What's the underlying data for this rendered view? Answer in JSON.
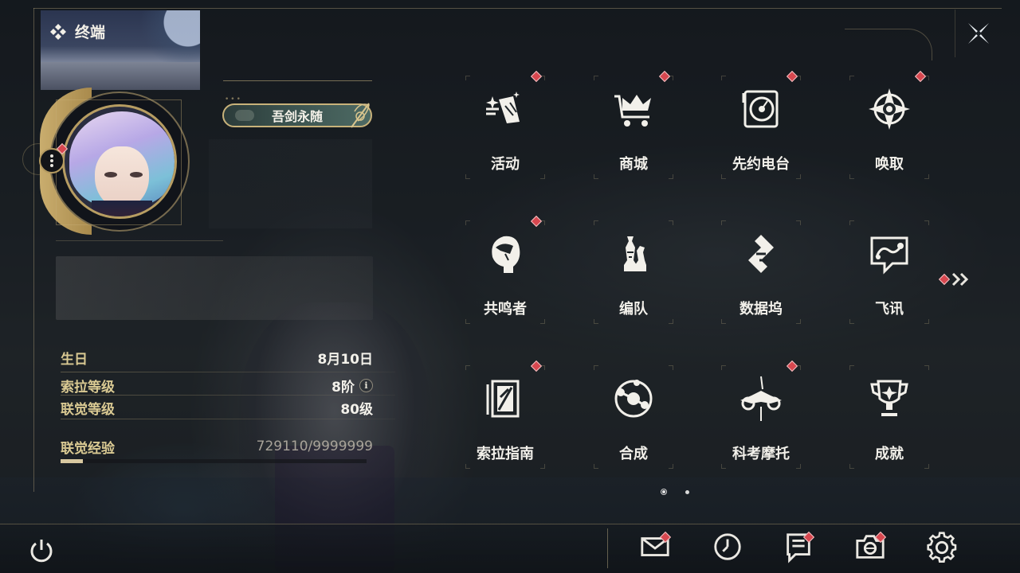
{
  "header": {
    "title": "终端",
    "title_icon": "diamond-cluster-icon",
    "close_icon": "close-x-icon"
  },
  "profile": {
    "avatar_icon": "character-avatar",
    "options_icon": "more-vertical-icon",
    "title_badge": "吾剑永随",
    "stats": {
      "birthday_label": "生日",
      "birthday_value": "8月10日",
      "sola_level_label": "索拉等级",
      "sola_level_value": "8阶",
      "union_level_label": "联觉等级",
      "union_level_value": "80级",
      "union_exp_label": "联觉经验",
      "union_exp_value": "729110/9999999",
      "union_exp_progress": 0.0729,
      "info_icon_text": "i"
    }
  },
  "grid": {
    "tiles": [
      {
        "label": "活动",
        "icon": "sparkle-activity-icon",
        "notify": true
      },
      {
        "label": "商城",
        "icon": "crown-cart-icon",
        "notify": true
      },
      {
        "label": "先约电台",
        "icon": "radio-disc-icon",
        "notify": true
      },
      {
        "label": "唤取",
        "icon": "compass-star-icon",
        "notify": true
      },
      {
        "label": "共鸣者",
        "icon": "character-head-icon",
        "notify": true
      },
      {
        "label": "编队",
        "icon": "chess-pieces-icon",
        "notify": false
      },
      {
        "label": "数据坞",
        "icon": "data-dock-icon",
        "notify": false
      },
      {
        "label": "飞讯",
        "icon": "chat-bubble-icon",
        "notify": false
      },
      {
        "label": "索拉指南",
        "icon": "guide-book-icon",
        "notify": true
      },
      {
        "label": "合成",
        "icon": "synthesis-orbit-icon",
        "notify": false
      },
      {
        "label": "科考摩托",
        "icon": "motorcycle-icon",
        "notify": true
      },
      {
        "label": "成就",
        "icon": "trophy-icon",
        "notify": false
      }
    ],
    "next_page_icon": "double-chevron-right-icon",
    "pages": 2,
    "current_page": 1
  },
  "bottom_bar": {
    "power_icon": "power-icon",
    "buttons": [
      {
        "icon": "mail-icon",
        "notify": true
      },
      {
        "icon": "clock-icon",
        "notify": false
      },
      {
        "icon": "notice-icon",
        "notify": true
      },
      {
        "icon": "camera-icon",
        "notify": true
      },
      {
        "icon": "settings-gear-icon",
        "notify": false
      }
    ]
  },
  "colors": {
    "accent_gold": "#c8b27a",
    "label_gold": "#d9c992",
    "notify_red": "#d7474f",
    "text_light": "#f2f0ea"
  }
}
